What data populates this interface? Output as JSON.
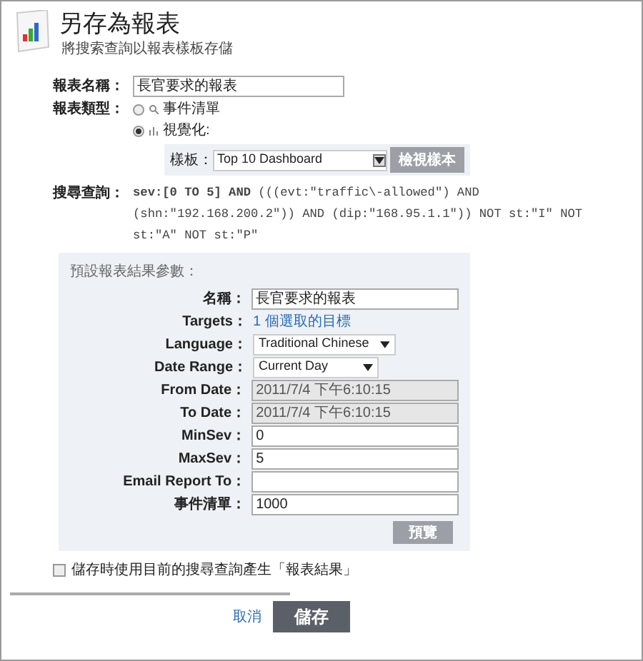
{
  "header": {
    "title": "另存為報表",
    "subtitle": "將搜索查詢以報表樣板存儲"
  },
  "report_name": {
    "label": "報表名稱：",
    "value": "長官要求的報表"
  },
  "report_type": {
    "label": "報表類型：",
    "options": [
      {
        "kind": "search",
        "label": "事件清單",
        "selected": false
      },
      {
        "kind": "chart",
        "label": "視覺化:",
        "selected": true
      }
    ]
  },
  "template": {
    "label": "樣板：",
    "value": "Top 10 Dashboard",
    "button": "檢視樣本"
  },
  "query": {
    "label": "搜尋查詢：",
    "value": "**sev:[0 TO 5] AND** (((evt:\"traffic\\-allowed\") AND (shn:\"192.168.200.2\")) AND (dip:\"168.95.1.1\")) NOT st:\"I\" NOT st:\"A\" NOT st:\"P\""
  },
  "params": {
    "title": "預設報表結果參數：",
    "fields": [
      {
        "kind": "text",
        "label": "名稱：",
        "value": "長官要求的報表"
      },
      {
        "kind": "link",
        "label": "Targets：",
        "value": "1 個選取的目標"
      },
      {
        "kind": "select",
        "label": "Language：",
        "value": "Traditional Chinese"
      },
      {
        "kind": "select",
        "label": "Date Range：",
        "value": "Current Day"
      },
      {
        "kind": "disabled",
        "label": "From Date：",
        "value": "2011/7/4 下午6:10:15"
      },
      {
        "kind": "disabled",
        "label": "To Date：",
        "value": "2011/7/4 下午6:10:15"
      },
      {
        "kind": "text",
        "label": "MinSev：",
        "value": "0"
      },
      {
        "kind": "text",
        "label": "MaxSev：",
        "value": "5"
      },
      {
        "kind": "text",
        "label": "Email Report To："
      },
      {
        "kind": "text",
        "label": "事件清單：",
        "value": "1000"
      }
    ],
    "button": "預覽"
  },
  "save_option": {
    "label": "儲存時使用目前的搜尋查詢產生「報表結果」",
    "checked": false
  },
  "cancel": "取消",
  "save": "儲存"
}
